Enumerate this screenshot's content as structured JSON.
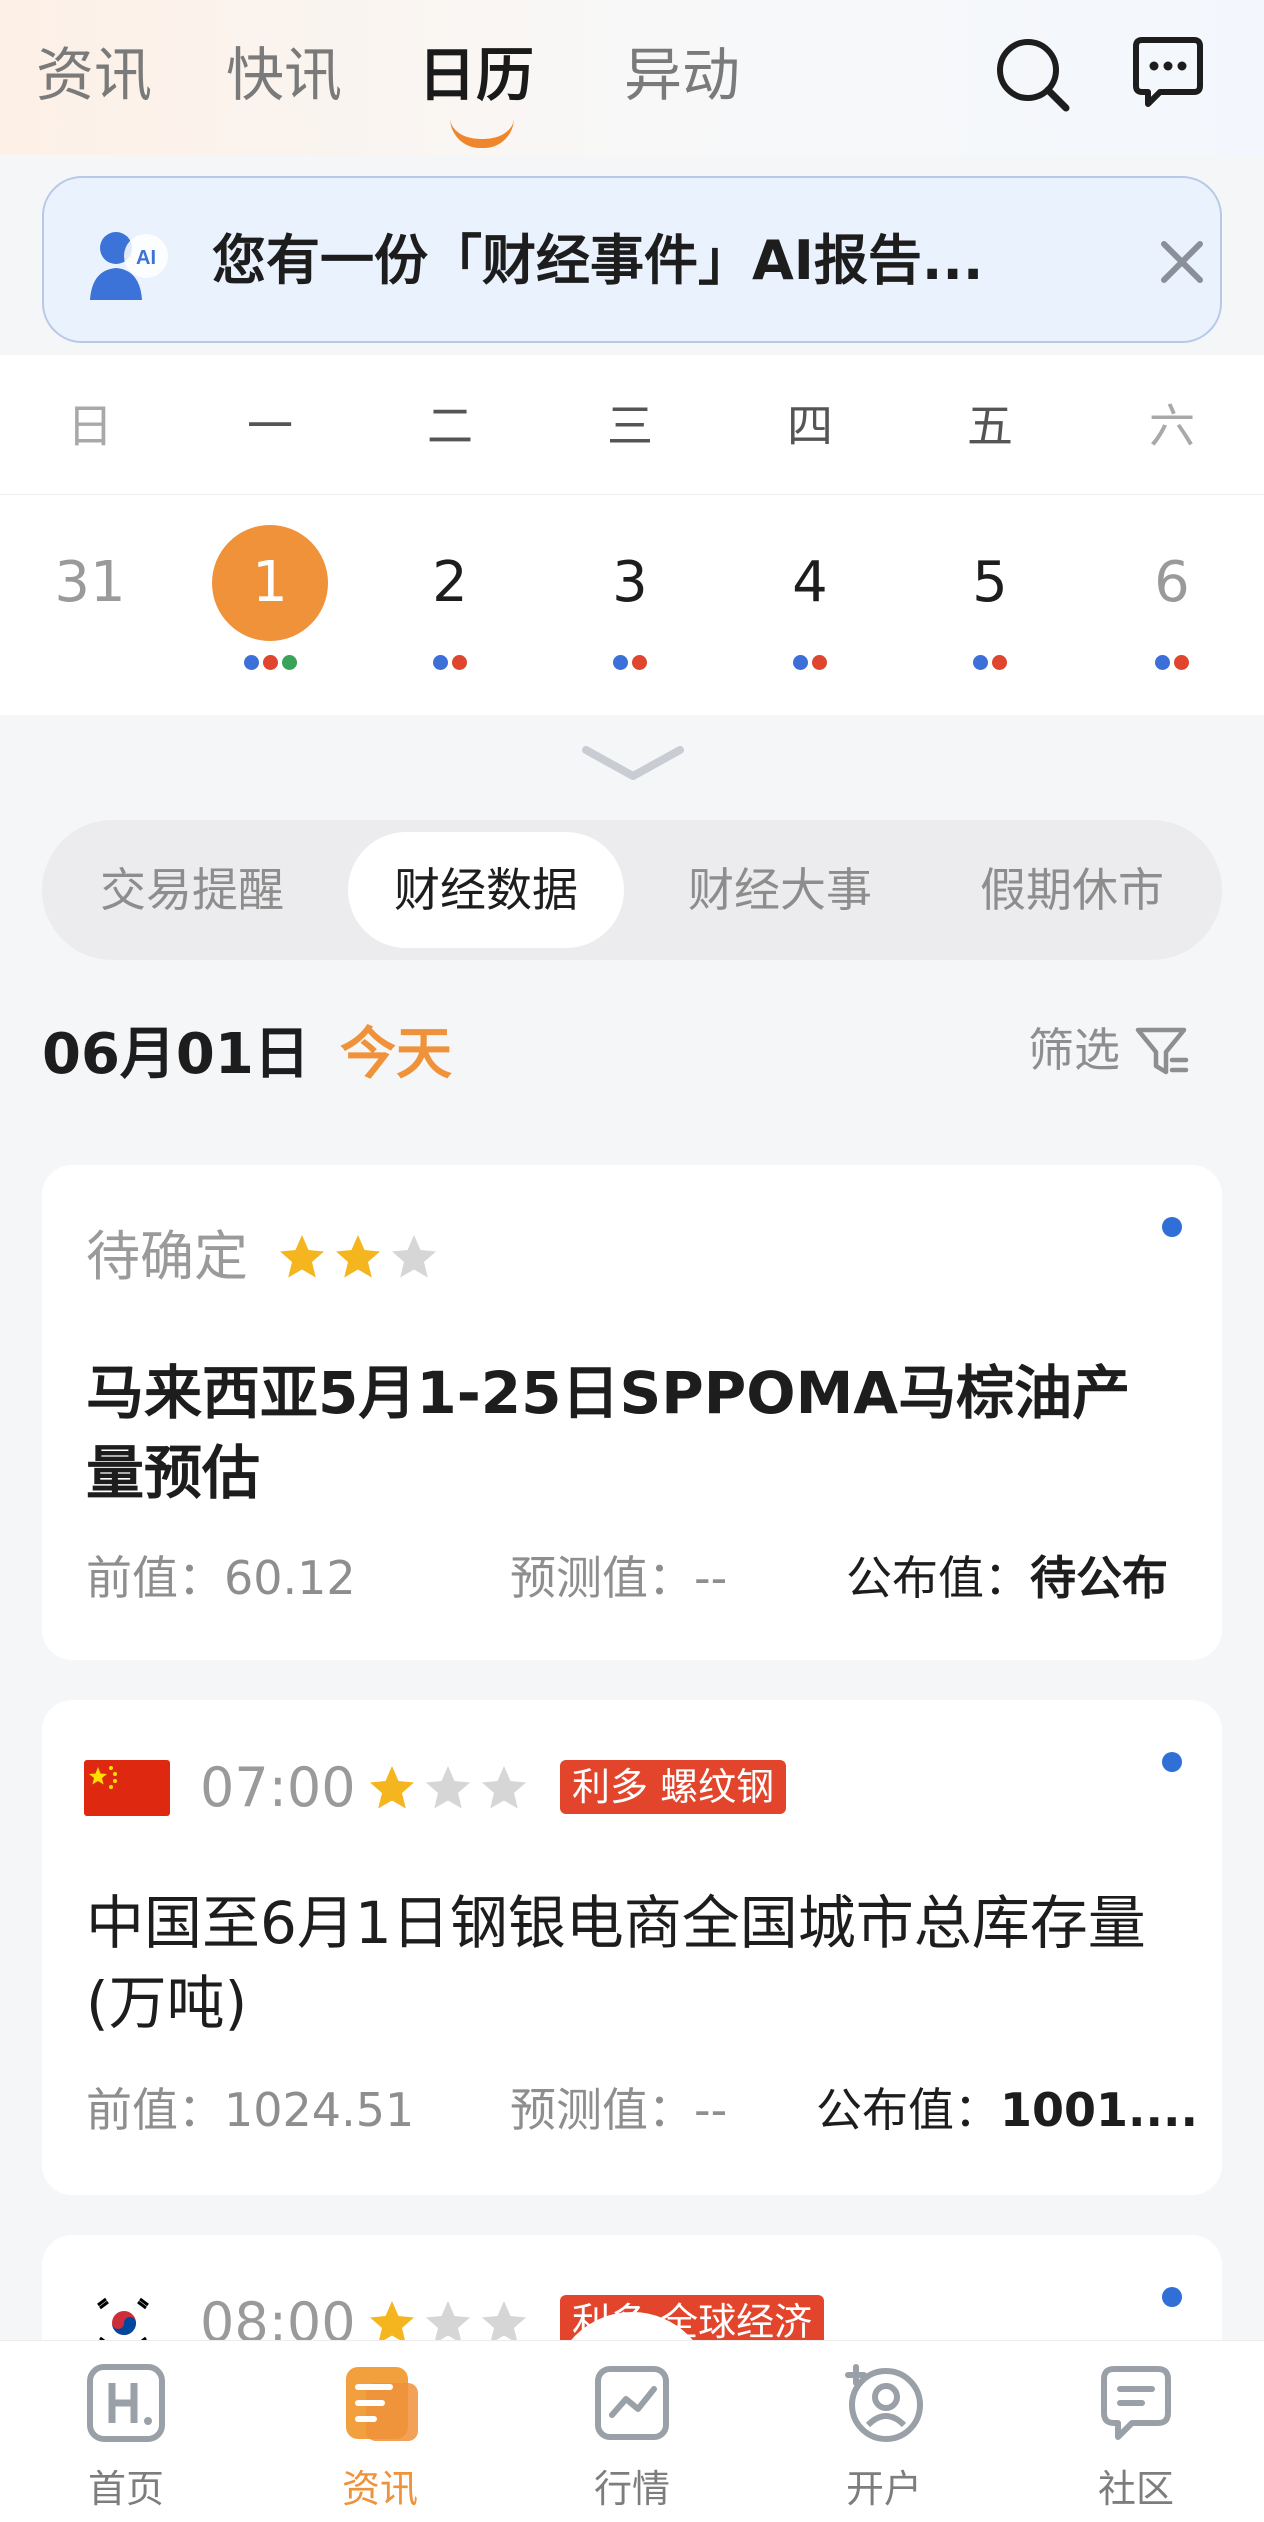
{
  "header": {
    "tabs": [
      {
        "label": "资讯",
        "active": false
      },
      {
        "label": "快讯",
        "active": false
      },
      {
        "label": "日历",
        "active": true
      },
      {
        "label": "异动",
        "active": false
      }
    ],
    "icons": [
      "search-icon",
      "message-icon"
    ]
  },
  "ai_banner": {
    "avatar_text": "AI",
    "text": "您有一份「财经事件」AI报告...",
    "close_icon": "close-icon"
  },
  "calendar": {
    "weekdays": [
      "日",
      "一",
      "二",
      "三",
      "四",
      "五",
      "六"
    ],
    "days": [
      {
        "num": "31",
        "selected": false,
        "weekend": true,
        "dots": []
      },
      {
        "num": "1",
        "selected": true,
        "weekend": false,
        "dots": [
          "#3d6fd8",
          "#e0452d",
          "#3aa35a"
        ]
      },
      {
        "num": "2",
        "selected": false,
        "weekend": false,
        "dots": [
          "#3d6fd8",
          "#e0452d"
        ]
      },
      {
        "num": "3",
        "selected": false,
        "weekend": false,
        "dots": [
          "#3d6fd8",
          "#e0452d"
        ]
      },
      {
        "num": "4",
        "selected": false,
        "weekend": false,
        "dots": [
          "#3d6fd8",
          "#e0452d"
        ]
      },
      {
        "num": "5",
        "selected": false,
        "weekend": false,
        "dots": [
          "#3d6fd8",
          "#e0452d"
        ]
      },
      {
        "num": "6",
        "selected": false,
        "weekend": true,
        "dots": [
          "#3d6fd8",
          "#e0452d"
        ]
      }
    ]
  },
  "segments": [
    {
      "label": "交易提醒",
      "active": false
    },
    {
      "label": "财经数据",
      "active": true
    },
    {
      "label": "财经大事",
      "active": false
    },
    {
      "label": "假期休市",
      "active": false
    }
  ],
  "date_row": {
    "date": "06月01日",
    "today": "今天",
    "filter_label": "筛选"
  },
  "events": [
    {
      "flag": "",
      "time": "待确定",
      "stars": 2,
      "tag": "",
      "title": "马来西亚5月1-25日SPPOMA马棕油产量预估",
      "title_bold": true,
      "prev_label": "前值：",
      "prev": "60.12",
      "forecast_label": "预测值：",
      "forecast": "--",
      "publish_label": "公布值：",
      "publish": "待公布"
    },
    {
      "flag": "china-flag",
      "time": "07:00",
      "stars": 1,
      "tag": "利多 螺纹钢",
      "title": "中国至6月1日钢银电商全国城市总库存量(万吨)",
      "title_bold": false,
      "prev_label": "前值：",
      "prev": "1024.51",
      "forecast_label": "预测值：",
      "forecast": "--",
      "publish_label": "公布值：",
      "publish": "1001...."
    },
    {
      "flag": "korea-flag",
      "time": "08:00",
      "stars": 1,
      "tag": "利多 全球经济",
      "title": "",
      "title_bold": false
    }
  ],
  "bottom_nav": [
    {
      "label": "首页",
      "icon": "home-icon",
      "active": false
    },
    {
      "label": "资讯",
      "icon": "news-icon",
      "active": true
    },
    {
      "label": "行情",
      "icon": "chart-icon",
      "active": false
    },
    {
      "label": "开户",
      "icon": "add-user-icon",
      "active": false
    },
    {
      "label": "社区",
      "icon": "community-icon",
      "active": false
    }
  ],
  "colors": {
    "accent": "#ef923a",
    "tag_red": "#e2452c",
    "dot_blue": "#2f6fd6",
    "star_gold": "#f5b51f",
    "star_gray": "#d6d6d6"
  }
}
